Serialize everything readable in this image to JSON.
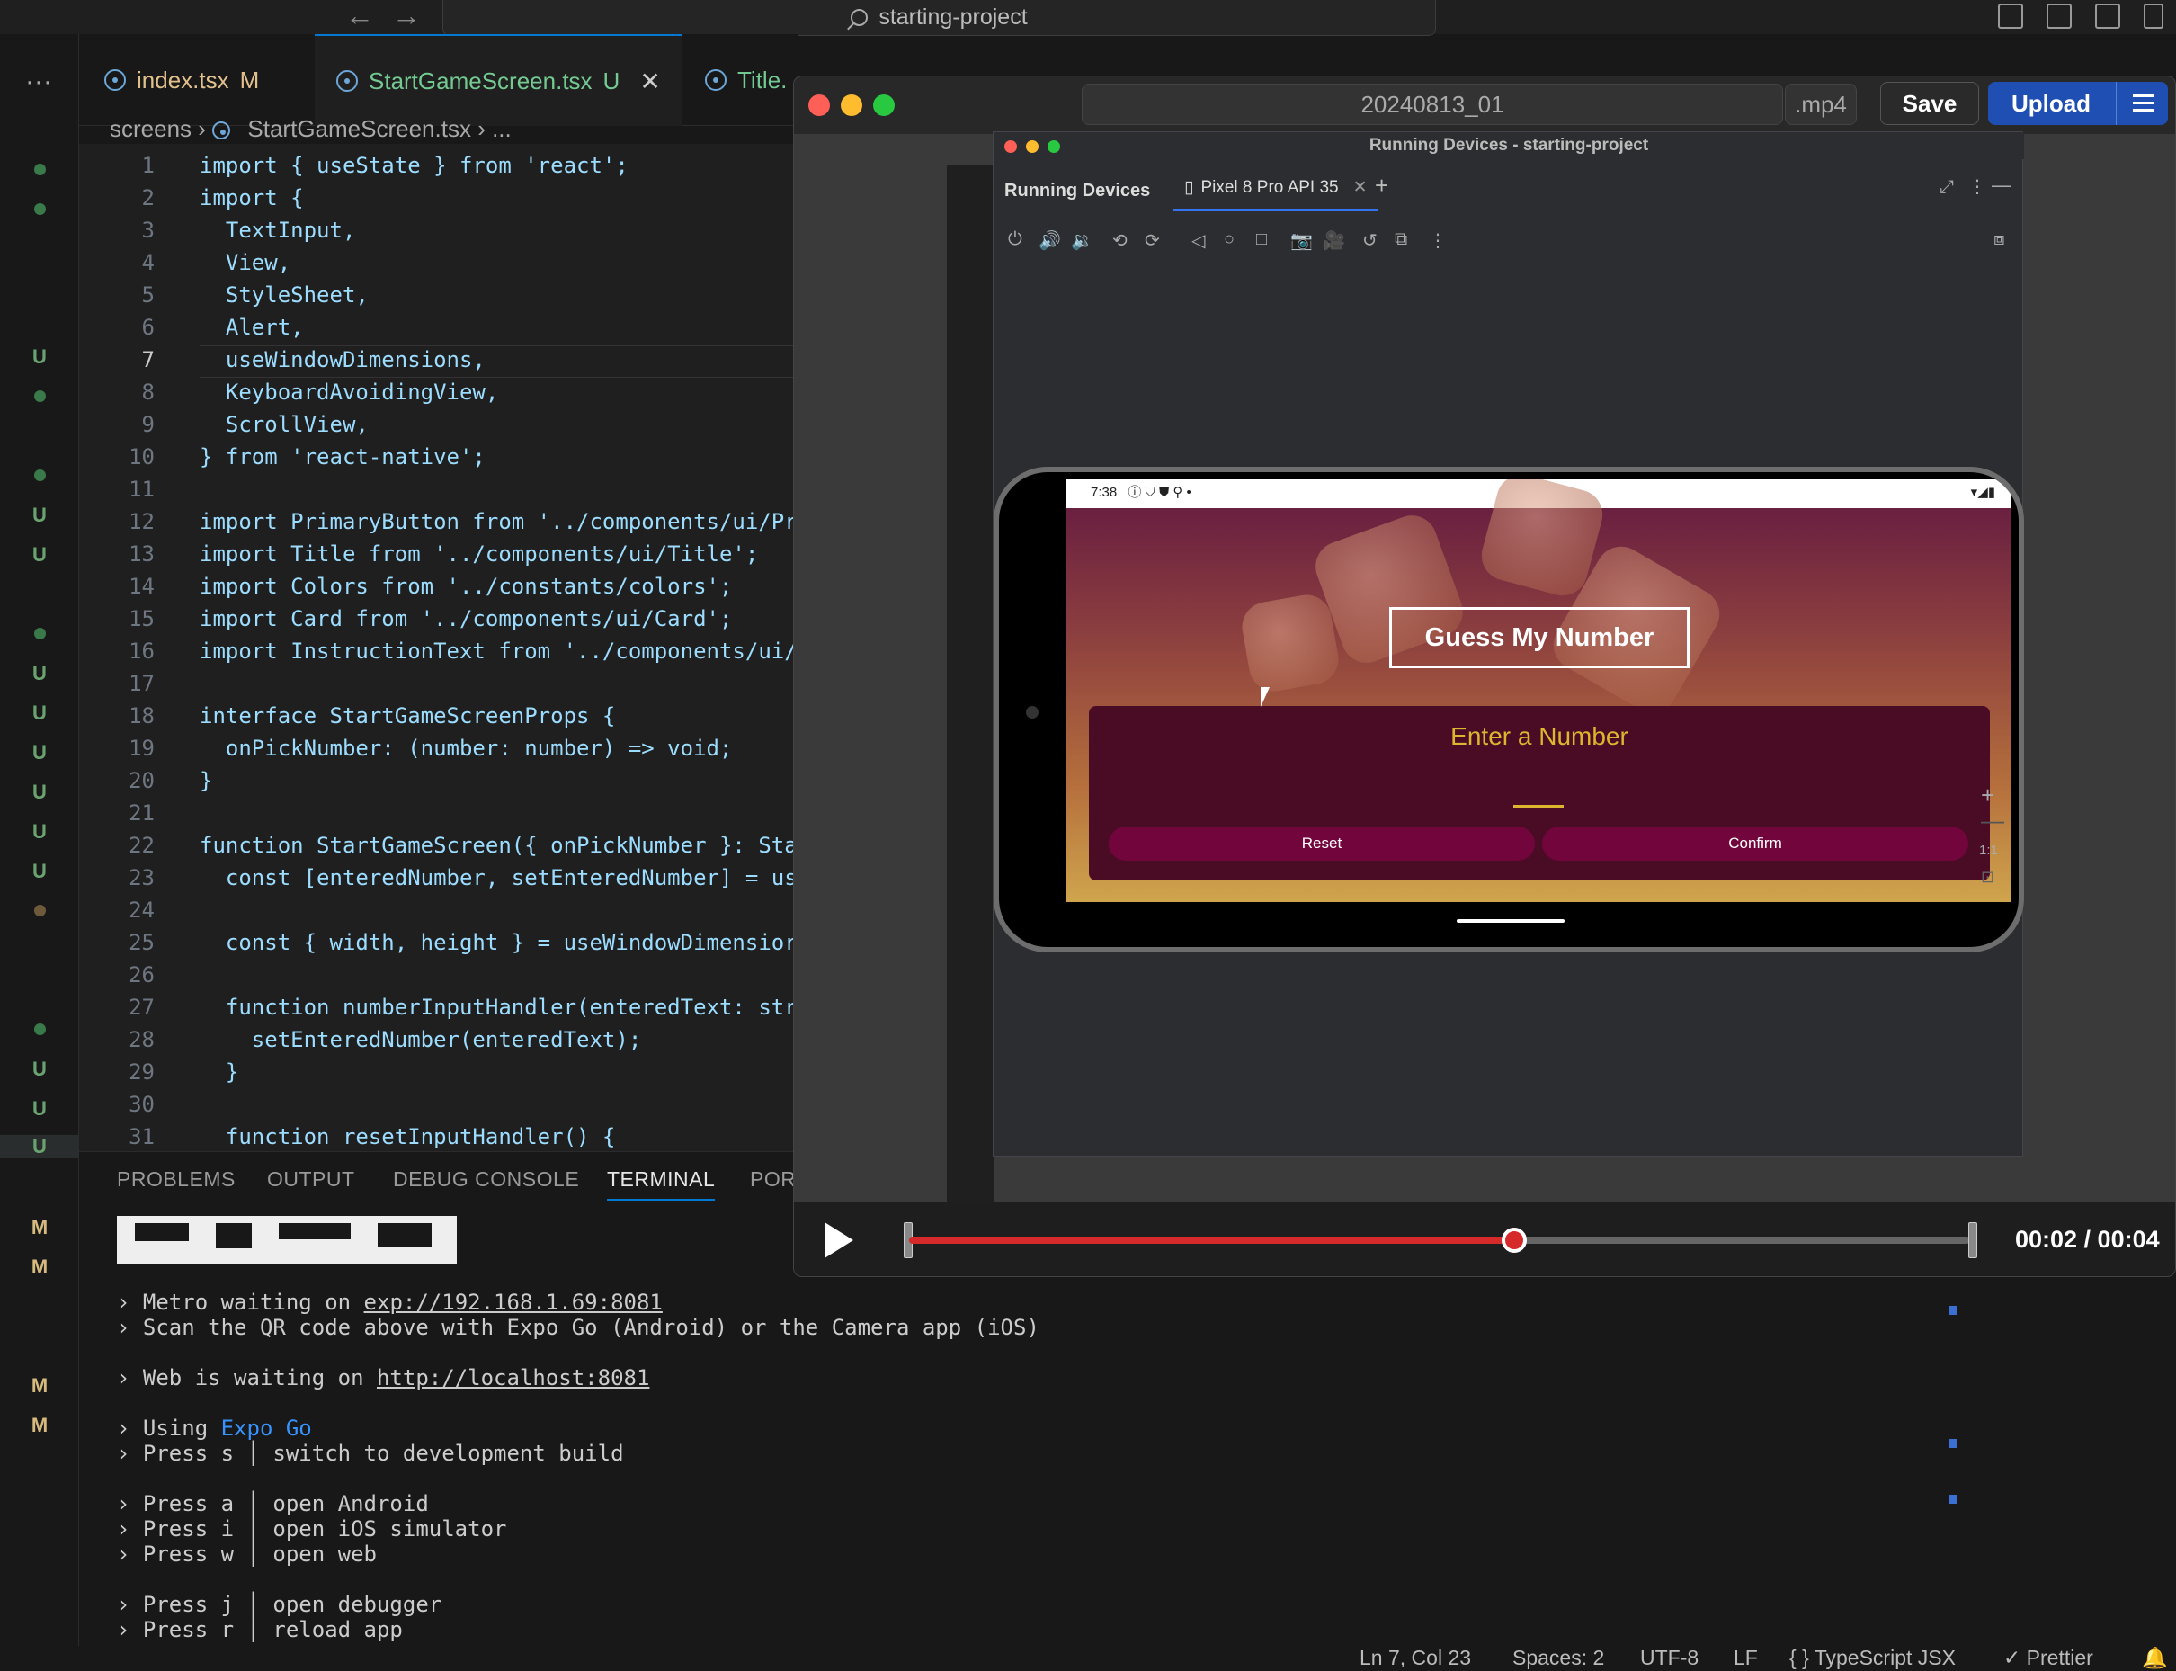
{
  "window": {
    "command_center": "starting-project"
  },
  "tabs": [
    {
      "label": "index.tsx",
      "badge": "M"
    },
    {
      "label": "StartGameScreen.tsx",
      "badge": "U"
    },
    {
      "label": "Title."
    }
  ],
  "breadcrumb": {
    "folder": "screens",
    "file": "StartGameScreen.tsx",
    "more": "..."
  },
  "git_markers": [
    "U",
    "U",
    "U",
    "U",
    "U",
    "U",
    "U",
    "U",
    "U",
    "U",
    "U",
    "M",
    "M",
    "M",
    "M"
  ],
  "editor": {
    "line_numbers": [
      "1",
      "2",
      "3",
      "4",
      "5",
      "6",
      "7",
      "8",
      "9",
      "10",
      "11",
      "12",
      "13",
      "14",
      "15",
      "16",
      "17",
      "18",
      "19",
      "20",
      "21",
      "22",
      "23",
      "24",
      "25",
      "26",
      "27",
      "28",
      "29",
      "30",
      "31"
    ],
    "lines": [
      "import { useState } from 'react';",
      "import {",
      "  TextInput,",
      "  View,",
      "  StyleSheet,",
      "  Alert,",
      "  useWindowDimensions,",
      "  KeyboardAvoidingView,",
      "  ScrollView,",
      "} from 'react-native';",
      "",
      "import PrimaryButton from '../components/ui/Pr",
      "import Title from '../components/ui/Title';",
      "import Colors from '../constants/colors';",
      "import Card from '../components/ui/Card';",
      "import InstructionText from '../components/ui/",
      "",
      "interface StartGameScreenProps {",
      "  onPickNumber: (number: number) => void;",
      "}",
      "",
      "function StartGameScreen({ onPickNumber }: Sta",
      "  const [enteredNumber, setEnteredNumber] = us",
      "",
      "  const { width, height } = useWindowDimensior",
      "",
      "  function numberInputHandler(enteredText: str",
      "    setEnteredNumber(enteredText);",
      "  }",
      "",
      "  function resetInputHandler() {"
    ]
  },
  "panel": {
    "tabs": [
      "PROBLEMS",
      "OUTPUT",
      "DEBUG CONSOLE",
      "TERMINAL",
      "POR"
    ],
    "active": "TERMINAL",
    "terminal": [
      {
        "prefix": "› Metro waiting on ",
        "link": "exp://192.168.1.69:8081",
        "rest": ""
      },
      {
        "prefix": "› Scan the QR code above with Expo Go (Android) or the Camera app (iOS)",
        "link": "",
        "rest": ""
      },
      {
        "prefix": "",
        "link": "",
        "rest": ""
      },
      {
        "prefix": "› Web is waiting on ",
        "link": "http://localhost:8081",
        "rest": ""
      },
      {
        "prefix": "",
        "link": "",
        "rest": ""
      },
      {
        "prefix": "› Using ",
        "link": "Expo Go",
        "rest": ""
      },
      {
        "prefix": "› Press s │ switch to development build",
        "link": "",
        "rest": ""
      },
      {
        "prefix": "",
        "link": "",
        "rest": ""
      },
      {
        "prefix": "› Press a │ open Android",
        "link": "",
        "rest": ""
      },
      {
        "prefix": "› Press i │ open iOS simulator",
        "link": "",
        "rest": ""
      },
      {
        "prefix": "› Press w │ open web",
        "link": "",
        "rest": ""
      },
      {
        "prefix": "",
        "link": "",
        "rest": ""
      },
      {
        "prefix": "› Press j │ open debugger",
        "link": "",
        "rest": ""
      },
      {
        "prefix": "› Press r │ reload app",
        "link": "",
        "rest": ""
      }
    ]
  },
  "statusbar": {
    "position": "Ln 7, Col 23",
    "spaces": "Spaces: 2",
    "encoding": "UTF-8",
    "eol": "LF",
    "language": "{ } TypeScript JSX",
    "formatter": "✓ Prettier"
  },
  "player": {
    "filename": "20240813_01",
    "extension": ".mp4",
    "save_label": "Save",
    "upload_label": "Upload",
    "time": "00:02 / 00:04",
    "progress": 0.57
  },
  "running_devices": {
    "window_title": "Running Devices - starting-project",
    "panel_title": "Running Devices",
    "device_tab": "Pixel 8 Pro API 35",
    "zoom_reset": "1:1",
    "phone": {
      "time": "7:38",
      "app_title": "Guess My Number",
      "card_title": "Enter a Number",
      "reset_label": "Reset",
      "confirm_label": "Confirm"
    }
  },
  "colors": {
    "accent_yellow": "#ddb52f",
    "card_bg": "#4a0b25",
    "button_bg": "#72063c",
    "upload_blue": "#1f4fb3",
    "scrubber_red": "#d62a2a"
  }
}
